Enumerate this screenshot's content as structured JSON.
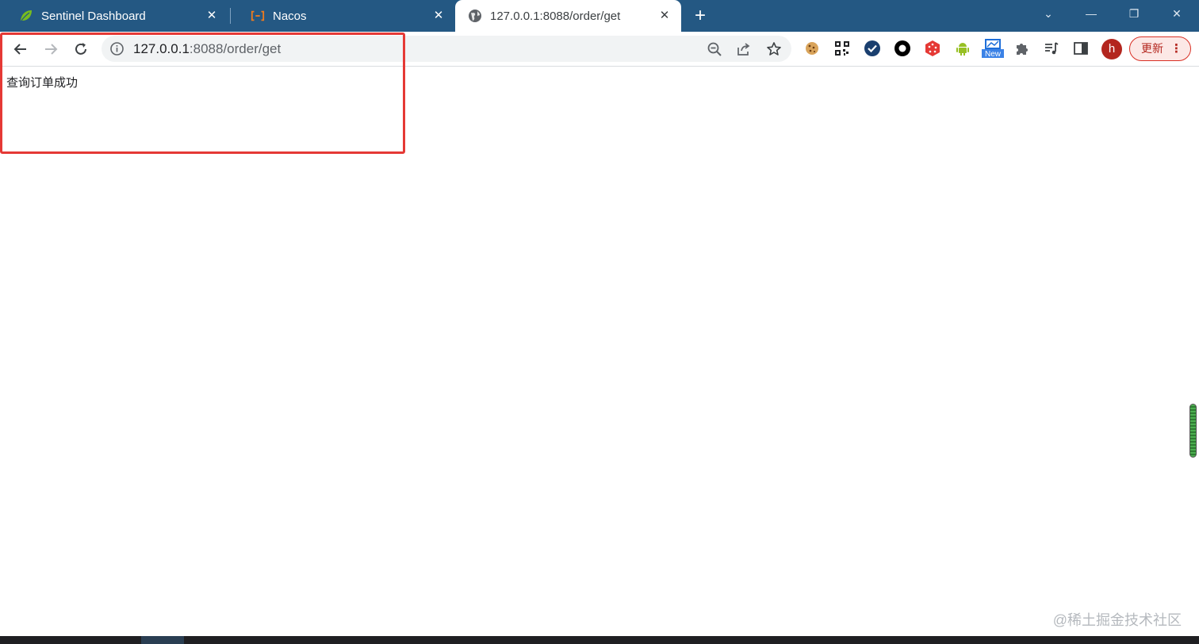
{
  "tabs": [
    {
      "title": "Sentinel Dashboard",
      "icon": "spring-leaf-icon"
    },
    {
      "title": "Nacos",
      "icon": "nacos-icon"
    },
    {
      "title": "127.0.0.1:8088/order/get",
      "icon": "globe-icon",
      "active": true
    }
  ],
  "window": {
    "minimize": "—",
    "restore": "❐",
    "close": "✕",
    "tab_search": "⌄",
    "new_tab": "+"
  },
  "address_bar": {
    "host": "127.0.0.1",
    "rest": ":8088/order/get"
  },
  "profile": {
    "initial": "h"
  },
  "update_button": {
    "label": "更新",
    "menu": "⋮"
  },
  "page": {
    "body_text": "查询订单成功"
  },
  "watermark": "@稀土掘金技术社区",
  "colors": {
    "tabstrip": "#245883",
    "highlight": "#e53935",
    "update_border": "#d93025"
  }
}
